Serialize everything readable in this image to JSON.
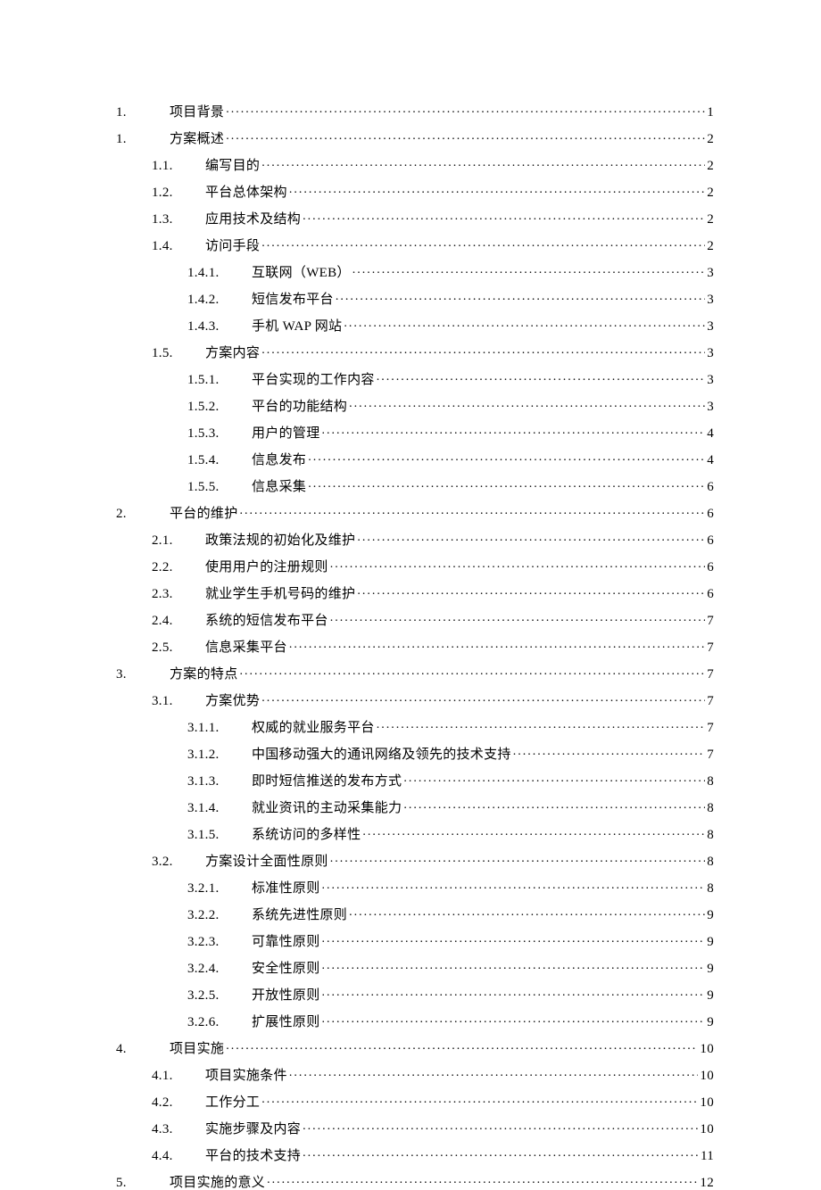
{
  "toc": [
    {
      "level": 1,
      "num": "1.",
      "title": "项目背景",
      "page": "1"
    },
    {
      "level": 1,
      "num": "1.",
      "title": "方案概述",
      "page": "2"
    },
    {
      "level": 2,
      "num": "1.1.",
      "title": "编写目的",
      "page": "2"
    },
    {
      "level": 2,
      "num": "1.2.",
      "title": "平台总体架构",
      "page": "2"
    },
    {
      "level": 2,
      "num": "1.3.",
      "title": "应用技术及结构",
      "page": "2"
    },
    {
      "level": 2,
      "num": "1.4.",
      "title": "访问手段",
      "page": "2"
    },
    {
      "level": 3,
      "num": "1.4.1.",
      "title": "互联网（WEB）",
      "page": "3"
    },
    {
      "level": 3,
      "num": "1.4.2.",
      "title": "短信发布平台",
      "page": "3"
    },
    {
      "level": 3,
      "num": "1.4.3.",
      "title": "手机 WAP 网站",
      "page": "3"
    },
    {
      "level": 2,
      "num": "1.5.",
      "title": "方案内容",
      "page": "3"
    },
    {
      "level": 3,
      "num": "1.5.1.",
      "title": "平台实现的工作内容",
      "page": "3"
    },
    {
      "level": 3,
      "num": "1.5.2.",
      "title": "平台的功能结构",
      "page": "3"
    },
    {
      "level": 3,
      "num": "1.5.3.",
      "title": "用户的管理",
      "page": "4"
    },
    {
      "level": 3,
      "num": "1.5.4.",
      "title": "信息发布",
      "page": "4"
    },
    {
      "level": 3,
      "num": "1.5.5.",
      "title": "信息采集",
      "page": "6"
    },
    {
      "level": 1,
      "num": "2.",
      "title": "平台的维护",
      "page": "6"
    },
    {
      "level": 2,
      "num": "2.1.",
      "title": "政策法规的初始化及维护",
      "page": "6"
    },
    {
      "level": 2,
      "num": "2.2.",
      "title": "使用用户的注册规则",
      "page": "6"
    },
    {
      "level": 2,
      "num": "2.3.",
      "title": "就业学生手机号码的维护",
      "page": "6"
    },
    {
      "level": 2,
      "num": "2.4.",
      "title": "系统的短信发布平台",
      "page": "7"
    },
    {
      "level": 2,
      "num": "2.5.",
      "title": "信息采集平台",
      "page": "7"
    },
    {
      "level": 1,
      "num": "3.",
      "title": "方案的特点",
      "page": "7"
    },
    {
      "level": 2,
      "num": "3.1.",
      "title": "方案优势",
      "page": "7"
    },
    {
      "level": 3,
      "num": "3.1.1.",
      "title": "权威的就业服务平台",
      "page": "7"
    },
    {
      "level": 3,
      "num": "3.1.2.",
      "title": "中国移动强大的通讯网络及领先的技术支持",
      "page": "7"
    },
    {
      "level": 3,
      "num": "3.1.3.",
      "title": "即时短信推送的发布方式",
      "page": "8"
    },
    {
      "level": 3,
      "num": "3.1.4.",
      "title": "就业资讯的主动采集能力",
      "page": "8"
    },
    {
      "level": 3,
      "num": "3.1.5.",
      "title": "系统访问的多样性",
      "page": "8"
    },
    {
      "level": 2,
      "num": "3.2.",
      "title": "方案设计全面性原则",
      "page": "8"
    },
    {
      "level": 3,
      "num": "3.2.1.",
      "title": "标准性原则",
      "page": "8"
    },
    {
      "level": 3,
      "num": "3.2.2.",
      "title": "系统先进性原则",
      "page": "9"
    },
    {
      "level": 3,
      "num": "3.2.3.",
      "title": "可靠性原则",
      "page": "9"
    },
    {
      "level": 3,
      "num": "3.2.4.",
      "title": "安全性原则",
      "page": "9"
    },
    {
      "level": 3,
      "num": "3.2.5.",
      "title": "开放性原则",
      "page": "9"
    },
    {
      "level": 3,
      "num": "3.2.6.",
      "title": "扩展性原则",
      "page": "9"
    },
    {
      "level": 1,
      "num": "4.",
      "title": "项目实施",
      "page": "10"
    },
    {
      "level": 2,
      "num": "4.1.",
      "title": "项目实施条件",
      "page": "10"
    },
    {
      "level": 2,
      "num": "4.2.",
      "title": "工作分工",
      "page": "10"
    },
    {
      "level": 2,
      "num": "4.3.",
      "title": "实施步骤及内容",
      "page": "10"
    },
    {
      "level": 2,
      "num": "4.4.",
      "title": "平台的技术支持",
      "page": "11"
    },
    {
      "level": 1,
      "num": "5.",
      "title": "项目实施的意义",
      "page": "12"
    }
  ]
}
